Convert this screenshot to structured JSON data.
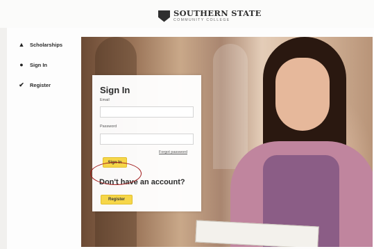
{
  "header": {
    "logo_name": "SOUTHERN STATE",
    "logo_subtitle": "COMMUNITY COLLEGE"
  },
  "sidebar": {
    "items": [
      {
        "label": "Scholarships",
        "icon": "graduation-cap-icon"
      },
      {
        "label": "Sign In",
        "icon": "lock-icon"
      },
      {
        "label": "Register",
        "icon": "checkmark-icon"
      }
    ]
  },
  "signin": {
    "title": "Sign In",
    "email_label": "Email",
    "email_value": "",
    "password_label": "Password",
    "password_value": "",
    "forgot_label": "Forgot password",
    "signin_button": "Sign In",
    "no_account_text": "Don't have an account?",
    "register_button": "Register"
  },
  "colors": {
    "button": "#f6d649",
    "annotation": "#a11a1a"
  }
}
